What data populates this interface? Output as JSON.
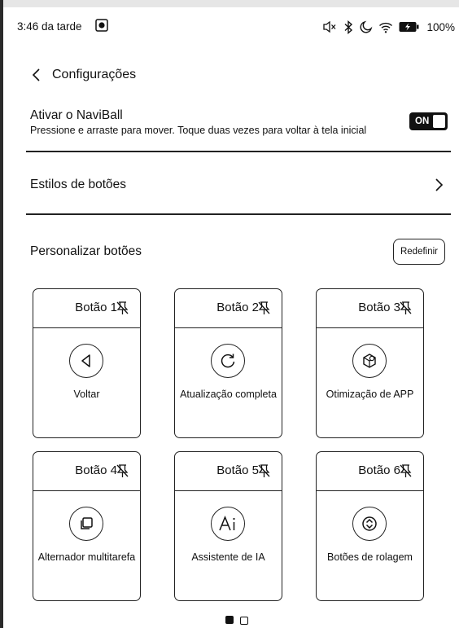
{
  "status_bar": {
    "time": "3:46 da tarde",
    "battery": "100%",
    "icons": [
      "app-icon",
      "mute-icon",
      "bluetooth-icon",
      "moon-icon",
      "wifi-icon",
      "battery-icon"
    ]
  },
  "header": {
    "back_icon": "chevron-left-icon",
    "title": "Configurações"
  },
  "naviball": {
    "title": "Ativar o NaviBall",
    "description": "Pressione e arraste para mover. Toque duas vezes para voltar à tela inicial",
    "toggle_label": "ON",
    "enabled": true
  },
  "button_styles": {
    "label": "Estilos de botões"
  },
  "customize": {
    "label": "Personalizar botões",
    "reset_label": "Redefinir"
  },
  "buttons": [
    {
      "title": "Botão 1",
      "function": "Voltar",
      "icon": "back-triangle-icon"
    },
    {
      "title": "Botão 2",
      "function": "Atualização completa",
      "icon": "refresh-icon"
    },
    {
      "title": "Botão 3",
      "function": "Otimização de APP",
      "icon": "app-optimize-icon"
    },
    {
      "title": "Botão 4",
      "function": "Alternador multitarefa",
      "icon": "multitask-icon"
    },
    {
      "title": "Botão 5",
      "function": "Assistente de IA",
      "icon": "ai-icon"
    },
    {
      "title": "Botão 6",
      "function": "Botões de rolagem",
      "icon": "scroll-icon"
    }
  ],
  "pagination": {
    "current": 1,
    "total": 2
  }
}
